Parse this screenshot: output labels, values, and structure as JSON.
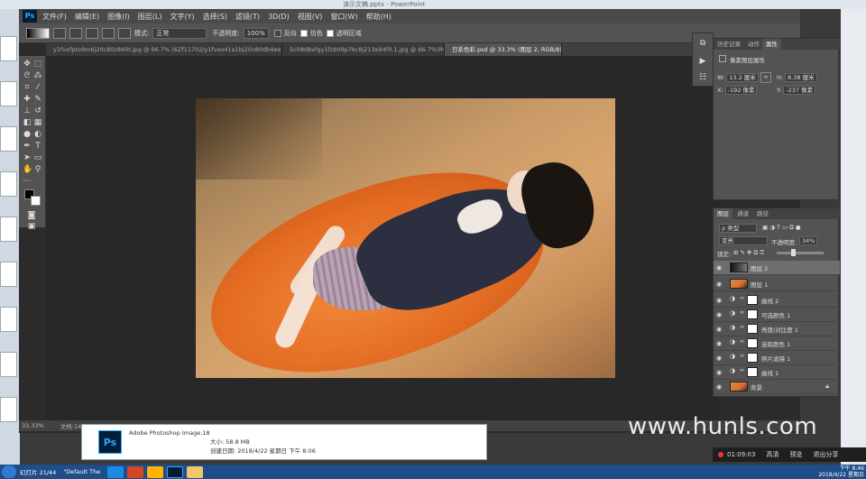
{
  "background_window": {
    "title_fragment": "演示文稿.pptx - PowerPoint"
  },
  "app": {
    "logo": "Ps",
    "menus": [
      "文件(F)",
      "编辑(E)",
      "图像(I)",
      "图层(L)",
      "文字(Y)",
      "选择(S)",
      "滤镜(T)",
      "3D(D)",
      "视图(V)",
      "窗口(W)",
      "帮助(H)"
    ]
  },
  "options_bar": {
    "mode_label": "模式:",
    "mode_value": "正常",
    "opacity_label": "不透明度:",
    "opacity_value": "100%",
    "reverse_label": "反向",
    "dither_label": "仿色",
    "transparency_label": "透明区域"
  },
  "tabs": [
    {
      "label": "y1fvxfpto9m6j20c80z840t.jpg @ 66.7% (6Zf11702/y1fvxo41a1bj20v80db4ee, RGB/8#) *",
      "active": false
    },
    {
      "label": "5c08d8afgy1fzb09p7kc8j213e94f0.1.jpg @ 66.7%(RGB/8#) *",
      "active": false
    },
    {
      "label": "日系色彩.psd @ 33.3% (图层 2, RGB/8) *",
      "active": true
    }
  ],
  "status_bar": {
    "zoom": "33.33%",
    "doc": "文档:14.8M/58.8M"
  },
  "properties": {
    "tabs": [
      "历史记录",
      "动作",
      "属性"
    ],
    "header": "像素图层属性",
    "w_label": "W:",
    "w_value": "13.2 厘米",
    "h_label": "H:",
    "h_value": "8.38 厘米",
    "x_label": "X:",
    "x_value": "-192 像素",
    "y_label": "Y:",
    "y_value": "-237 像素"
  },
  "layers_panel": {
    "tabs": [
      "图层",
      "通道",
      "路径"
    ],
    "filter_label": "ρ 类型",
    "blend_mode": "变亮",
    "opacity_label": "不透明度:",
    "opacity_value": "34%",
    "lock_label": "锁定:",
    "layers": [
      {
        "name": "图层 2",
        "type": "pixel",
        "selected": true
      },
      {
        "name": "图层 1",
        "type": "photo",
        "selected": false
      },
      {
        "name": "曲线 2",
        "type": "adjustment",
        "selected": false
      },
      {
        "name": "可选颜色 1",
        "type": "adjustment",
        "selected": false
      },
      {
        "name": "亮度/对比度 1",
        "type": "adjustment",
        "selected": false
      },
      {
        "name": "选取颜色 1",
        "type": "adjustment",
        "selected": false
      },
      {
        "name": "照片滤镜 1",
        "type": "adjustment",
        "selected": false
      },
      {
        "name": "曲线 1",
        "type": "adjustment",
        "selected": false
      },
      {
        "name": "背景",
        "type": "photo",
        "selected": false
      }
    ]
  },
  "explorer": {
    "name": "Adobe Photoshop Image.18",
    "size_label": "大小: 58.8 MB",
    "created": "创建日期: 2018/4/22 星期日 下午 8:06"
  },
  "watermark": "www.hunls.com",
  "recorder": {
    "time": "01:09:03",
    "hd": "高清",
    "preview": "预览",
    "exit": "退出分享"
  },
  "taskbar": {
    "slide_info": "幻灯片 21/44",
    "theme": "\"Default The",
    "clock_time": "下午 8:46",
    "clock_date": "2018/4/22 星期日"
  },
  "colors": {
    "ps_bg": "#2b2b2b",
    "panel": "#535353",
    "accent": "#31a8ff",
    "taskbar": "#1d4e8a"
  }
}
